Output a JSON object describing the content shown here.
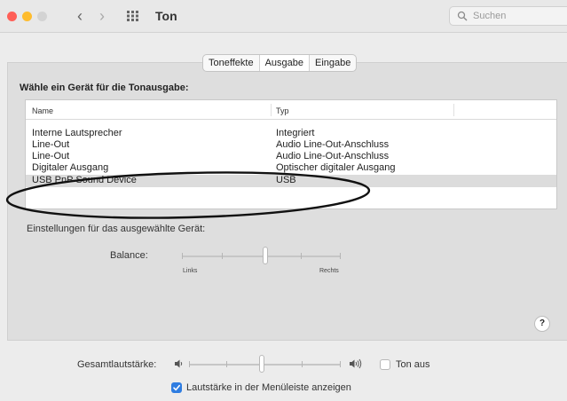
{
  "window": {
    "title": "Ton"
  },
  "search": {
    "placeholder": "Suchen"
  },
  "tabs": [
    {
      "label": "Toneffekte",
      "active": false
    },
    {
      "label": "Ausgabe",
      "active": true
    },
    {
      "label": "Eingabe",
      "active": false
    }
  ],
  "output": {
    "heading": "Wähle ein Gerät für die Tonausgabe:",
    "columns": {
      "name": "Name",
      "type": "Typ"
    },
    "devices": [
      {
        "name": "Interne Lautsprecher",
        "type": "Integriert",
        "selected": false
      },
      {
        "name": "Line-Out",
        "type": "Audio Line-Out-Anschluss",
        "selected": false
      },
      {
        "name": "Line-Out",
        "type": "Audio Line-Out-Anschluss",
        "selected": false
      },
      {
        "name": "Digitaler Ausgang",
        "type": "Optischer digitaler Ausgang",
        "selected": false
      },
      {
        "name": "USB PnP Sound Device",
        "type": "USB",
        "selected": true
      }
    ]
  },
  "settings": {
    "label": "Einstellungen für das ausgewählte Gerät:",
    "balance": {
      "label": "Balance:",
      "left": "Links",
      "right": "Rechts",
      "value": 0.5
    }
  },
  "help": {
    "label": "?"
  },
  "volume": {
    "label": "Gesamtlautstärke:",
    "value": 0.47,
    "mute_label": "Ton aus",
    "mute_checked": false,
    "menubar_label": "Lautstärke in der Menüleiste anzeigen",
    "menubar_checked": true
  },
  "colors": {
    "accent": "#2f7de1",
    "selection": "#dcdcdc"
  }
}
